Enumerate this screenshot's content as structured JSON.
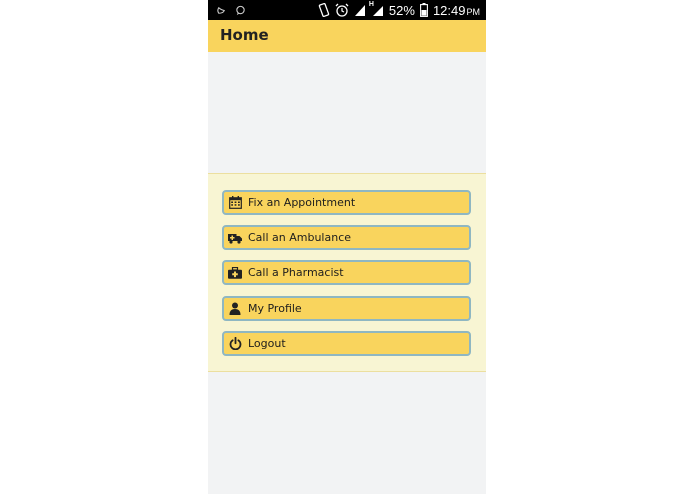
{
  "status_bar": {
    "battery_percent": "52%",
    "time": "12:49",
    "ampm": "PM",
    "network_label": "H"
  },
  "app_bar": {
    "title": "Home",
    "background": "#f9d45d"
  },
  "menu": {
    "items": [
      {
        "label": "Fix an Appointment",
        "icon": "calendar-icon"
      },
      {
        "label": "Call an Ambulance",
        "icon": "ambulance-icon"
      },
      {
        "label": "Call a Pharmacist",
        "icon": "medical-kit-icon"
      },
      {
        "label": "My Profile",
        "icon": "user-icon"
      },
      {
        "label": "Logout",
        "icon": "power-icon"
      }
    ]
  },
  "colors": {
    "accent": "#f9d45d",
    "button_border": "#8fb7c2",
    "panel_background": "#f8f5d3",
    "page_background": "#f2f3f4"
  }
}
